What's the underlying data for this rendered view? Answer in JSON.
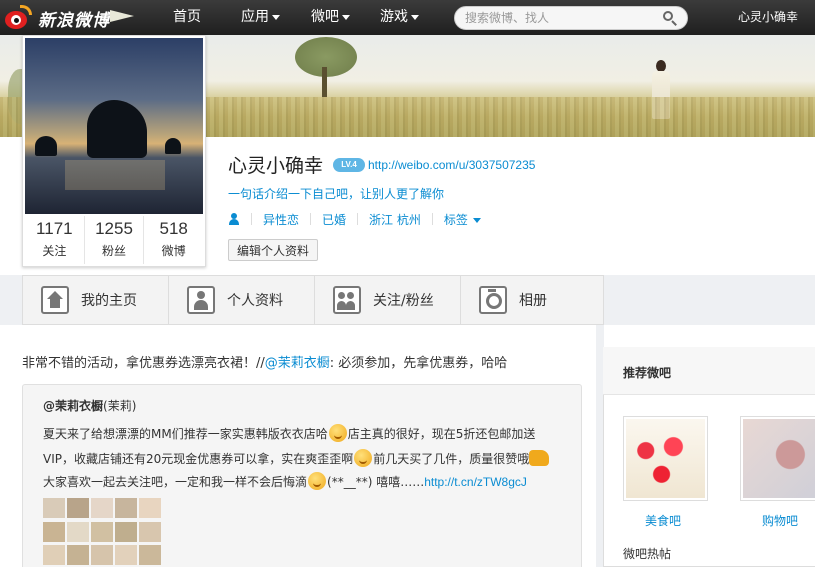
{
  "nav": {
    "logo_text": "新浪微博",
    "items": [
      {
        "label": "首页"
      },
      {
        "label": "应用"
      },
      {
        "label": "微吧"
      },
      {
        "label": "游戏"
      }
    ],
    "search_placeholder": "搜索微博、找人",
    "user": "心灵小确幸"
  },
  "profile": {
    "name": "心灵小确幸",
    "level": "LV.4",
    "url": "http://weibo.com/u/3037507235",
    "intro": "一句话介绍一下自己吧，让别人更了解你",
    "orientation": "异性恋",
    "relationship": "已婚",
    "location": "浙江 杭州",
    "tags_label": "标签",
    "edit_button": "编辑个人资料",
    "stats": [
      {
        "num": "1171",
        "label": "关注"
      },
      {
        "num": "1255",
        "label": "粉丝"
      },
      {
        "num": "518",
        "label": "微博"
      }
    ]
  },
  "tabs": [
    {
      "label": "我的主页",
      "icon": "home-icon"
    },
    {
      "label": "个人资料",
      "icon": "person-icon"
    },
    {
      "label": "关注/粉丝",
      "icon": "people-icon"
    },
    {
      "label": "相册",
      "icon": "camera-icon"
    }
  ],
  "post": {
    "text_before": "非常不错的活动，拿优惠券选漂亮衣裙！//",
    "mention": "@茉莉衣橱",
    "text_after": ": 必须参加，先拿优惠券，哈哈",
    "repost": {
      "user": "@茉莉衣橱",
      "user_suffix": "(茉莉)",
      "line1a": "夏天来了给想漂漂的MM们推荐一家实惠韩版衣衣店哈",
      "line1b": "店主真的很好，现在5折还包邮加送",
      "line2a": "VIP，收藏店铺还有20元现金优惠券可以拿，实在爽歪歪啊",
      "line2b": "前几天买了几件，质量很赞哦",
      "line3a": "大家喜欢一起去关注吧，一定和我一样不会后悔滴",
      "line3b": "(**__**) 嘻嘻……",
      "link": "http://t.cn/zTW8gcJ"
    }
  },
  "sidebar": {
    "title": "推荐微吧",
    "groups": [
      {
        "label": "美食吧"
      },
      {
        "label": "购物吧"
      }
    ],
    "sub_title": "微吧热帖"
  }
}
